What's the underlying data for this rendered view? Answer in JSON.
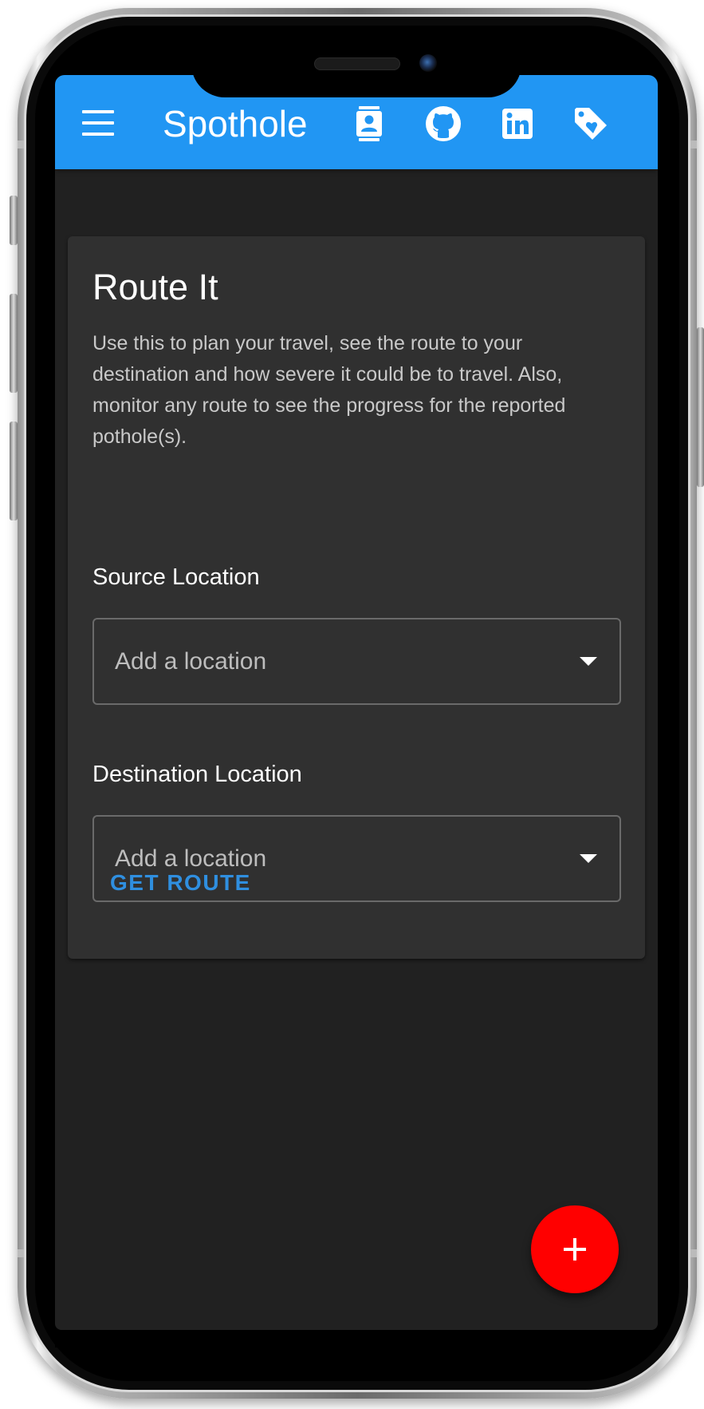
{
  "app": {
    "title": "Spothole"
  },
  "appbar": {
    "icons": [
      "menu-icon",
      "contact-card-icon",
      "github-icon",
      "linkedin-icon",
      "tag-heart-icon"
    ]
  },
  "card": {
    "title": "Route It",
    "description": "Use this to plan your travel, see the route to your destination and how severe it could be to travel. Also, monitor any route to see the progress for the reported pothole(s).",
    "source": {
      "label": "Source Location",
      "placeholder": "Add a location"
    },
    "destination": {
      "label": "Destination Location",
      "placeholder": "Add a location"
    },
    "action_label": "GET ROUTE"
  },
  "fab": {
    "icon": "plus-icon"
  },
  "colors": {
    "appbar": "#2196f3",
    "background": "#212121",
    "card": "#303030",
    "accent": "#2f8fe0",
    "fab": "#ff0000"
  }
}
